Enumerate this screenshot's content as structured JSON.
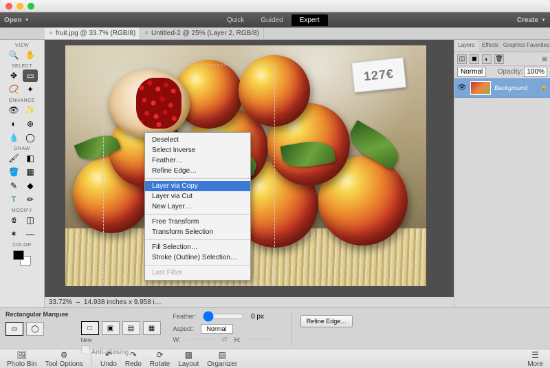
{
  "topbar": {
    "open_label": "Open",
    "create_label": "Create",
    "modes": {
      "quick": "Quick",
      "guided": "Guided",
      "expert": "Expert"
    }
  },
  "tabs": [
    {
      "label": "fruit.jpg @ 33.7% (RGB/8)",
      "active": true
    },
    {
      "label": "Untitled-2 @ 25% (Layer 2, RGB/8)",
      "active": false
    }
  ],
  "tool_groups": {
    "view": "VIEW",
    "select": "SELECT",
    "enhance": "ENHANCE",
    "draw": "DRAW",
    "modify": "MODIFY",
    "color": "COLOR"
  },
  "status_bar": {
    "zoom": "33.72%",
    "doc_info": "14.938 inches x 9.958 i…"
  },
  "right_panel": {
    "tabs": [
      "Layers",
      "Effects",
      "Graphics",
      "Favorites"
    ],
    "blend_mode": "Normal",
    "opacity_label": "Opacity:",
    "opacity_value": "100%",
    "layer_name": "Background"
  },
  "options_bar": {
    "tool_name": "Rectangular Marquee",
    "new_label": "New",
    "feather_label": "Feather:",
    "feather_value": "0 px",
    "aspect_label": "Aspect:",
    "aspect_value": "Normal",
    "w_label": "W:",
    "h_label": "H:",
    "aa_label": "Anti-aliasing",
    "refine_label": "Refine Edge…"
  },
  "footer": {
    "photo_bin": "Photo Bin",
    "tool_options": "Tool Options",
    "undo": "Undo",
    "redo": "Redo",
    "rotate": "Rotate",
    "layout": "Layout",
    "organizer": "Organizer",
    "more": "More"
  },
  "context_menu": {
    "items": [
      {
        "label": "Deselect",
        "type": "item"
      },
      {
        "label": "Select Inverse",
        "type": "item"
      },
      {
        "label": "Feather…",
        "type": "item"
      },
      {
        "label": "Refine Edge…",
        "type": "item"
      },
      {
        "type": "sep"
      },
      {
        "label": "Layer via Copy",
        "type": "item",
        "highlight": true
      },
      {
        "label": "Layer via Cut",
        "type": "item"
      },
      {
        "label": "New Layer…",
        "type": "item"
      },
      {
        "type": "sep"
      },
      {
        "label": "Free Transform",
        "type": "item"
      },
      {
        "label": "Transform Selection",
        "type": "item"
      },
      {
        "type": "sep"
      },
      {
        "label": "Fill Selection…",
        "type": "item"
      },
      {
        "label": "Stroke (Outline) Selection…",
        "type": "item"
      },
      {
        "type": "sep"
      },
      {
        "label": "Last Filter",
        "type": "item",
        "disabled": true
      }
    ]
  },
  "price_tag": "127€"
}
